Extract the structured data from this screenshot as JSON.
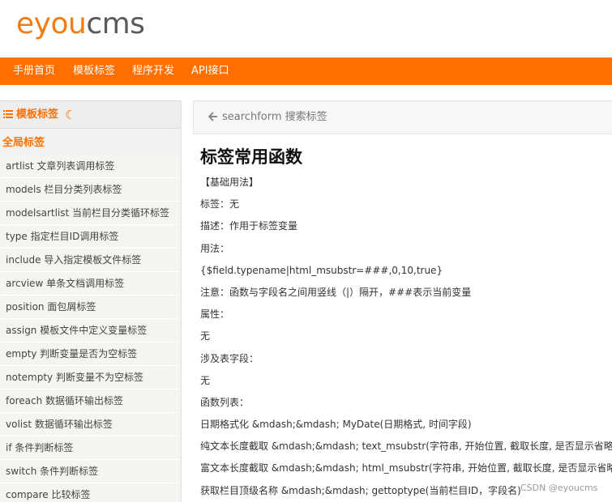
{
  "logo": {
    "e": "e",
    "you": "you",
    "cms": "cms"
  },
  "nav": [
    "手册首页",
    "模板标签",
    "程序开发",
    "API接口"
  ],
  "sidebar": {
    "title": "模板标签",
    "category": "全局标签",
    "items": [
      "artlist 文章列表调用标签",
      "models 栏目分类列表标签",
      "modelsartlist 当前栏目分类循环标签",
      "type 指定栏目ID调用标签",
      "include 导入指定模板文件标签",
      "arcview 单条文档调用标签",
      "position 面包屑标签",
      "assign 模板文件中定义变量标签",
      "empty 判断变量是否为空标签",
      "notempty 判断变量不为空标签",
      "foreach 数据循环输出标签",
      "volist 数据循环输出标签",
      "if 条件判断标签",
      "switch 条件判断标签",
      "compare 比较标签"
    ]
  },
  "breadcrumb": "searchform 搜索标签",
  "main": {
    "heading": "标签常用函数",
    "lines": [
      "【基础用法】",
      "标签：无",
      "描述：作用于标签变量",
      "用法：",
      "{$field.typename|html_msubstr=###,0,10,true}",
      "注意：函数与字段名之间用竖线（|）隔开，###表示当前变量",
      "属性：",
      "无",
      "涉及表字段：",
      "无",
      "函数列表：",
      "日期格式化 &mdash;&mdash; MyDate(日期格式, 时间字段)",
      "纯文本长度截取 &mdash;&mdash; text_msubstr(字符串, 开始位置, 截取长度, 是否显示省略",
      "富文本长度截取 &mdash;&mdash; html_msubstr(字符串, 开始位置, 截取长度, 是否显示省略",
      "获取栏目顶级名称 &mdash;&mdash; gettoptype(当前栏目ID，字段名)"
    ]
  },
  "watermark": "CSDN @eyoucms",
  "colors": {
    "accent": "#ff6f00",
    "logo_orange": "#f07d12",
    "logo_gray": "#5a5a5a"
  }
}
